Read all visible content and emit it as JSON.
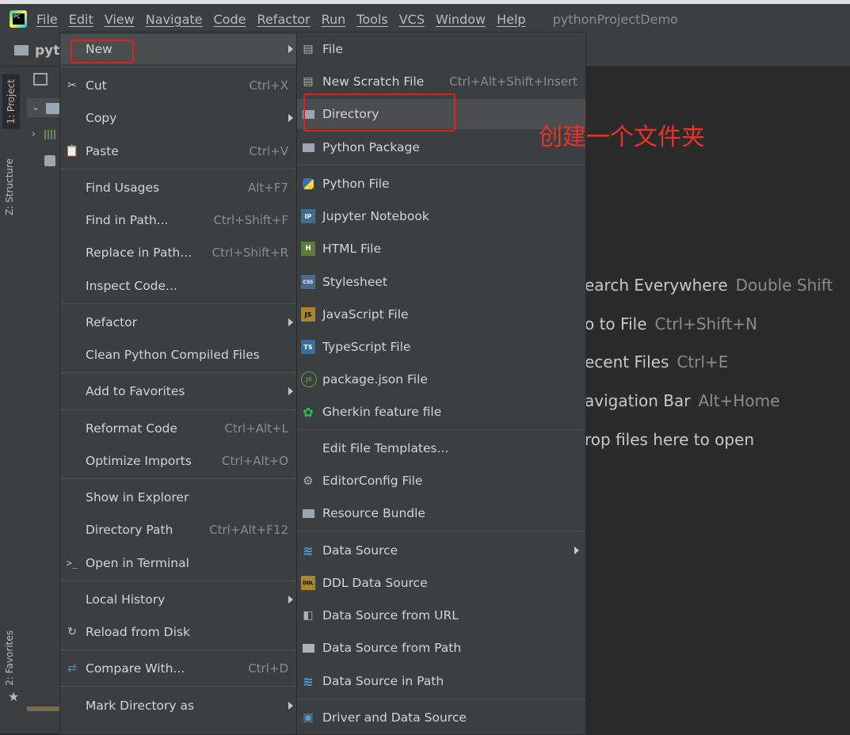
{
  "menubar": {
    "items": [
      "File",
      "Edit",
      "View",
      "Navigate",
      "Code",
      "Refactor",
      "Run",
      "Tools",
      "VCS",
      "Window",
      "Help"
    ],
    "project": "pythonProjectDemo",
    "logo": "PC"
  },
  "nav": {
    "title": "pyth"
  },
  "toolstrip": {
    "project_tab": "1: Project",
    "structure_tab": "Z: Structure",
    "favorites_tab": "2: Favorites"
  },
  "hints": [
    {
      "label": "earch Everywhere",
      "shortcut": "Double Shift"
    },
    {
      "label": "o to File",
      "shortcut": "Ctrl+Shift+N"
    },
    {
      "label": "ecent Files",
      "shortcut": "Ctrl+E"
    },
    {
      "label": "avigation Bar",
      "shortcut": "Alt+Home"
    },
    {
      "label": "rop files here to open",
      "shortcut": ""
    }
  ],
  "context_menu": {
    "new": "New",
    "cut": {
      "label": "Cut",
      "shortcut": "Ctrl+X"
    },
    "copy": "Copy",
    "paste": {
      "label": "Paste",
      "shortcut": "Ctrl+V"
    },
    "find_usages": {
      "label": "Find Usages",
      "shortcut": "Alt+F7"
    },
    "find_in_path": {
      "label": "Find in Path...",
      "shortcut": "Ctrl+Shift+F"
    },
    "replace_in_path": {
      "label": "Replace in Path...",
      "shortcut": "Ctrl+Shift+R"
    },
    "inspect_code": "Inspect Code...",
    "refactor": "Refactor",
    "clean": "Clean Python Compiled Files",
    "add_favorites": "Add to Favorites",
    "reformat": {
      "label": "Reformat Code",
      "shortcut": "Ctrl+Alt+L"
    },
    "optimize": {
      "label": "Optimize Imports",
      "shortcut": "Ctrl+Alt+O"
    },
    "show_explorer": "Show in Explorer",
    "dir_path": {
      "label": "Directory Path",
      "shortcut": "Ctrl+Alt+F12"
    },
    "terminal": "Open in Terminal",
    "local_history": "Local History",
    "reload": "Reload from Disk",
    "compare": {
      "label": "Compare With...",
      "shortcut": "Ctrl+D"
    },
    "mark_dir": "Mark Directory as"
  },
  "submenu": {
    "file": "File",
    "scratch": {
      "label": "New Scratch File",
      "shortcut": "Ctrl+Alt+Shift+Insert"
    },
    "directory": "Directory",
    "python_package": "Python Package",
    "python_file": "Python File",
    "jupyter": "Jupyter Notebook",
    "html": "HTML File",
    "stylesheet": "Stylesheet",
    "js": "JavaScript File",
    "ts": "TypeScript File",
    "package_json": "package.json File",
    "gherkin": "Gherkin feature file",
    "edit_templates": "Edit File Templates...",
    "editorconfig": "EditorConfig File",
    "resource_bundle": "Resource Bundle",
    "data_source": "Data Source",
    "ddl": "DDL Data Source",
    "ds_url": "Data Source from URL",
    "ds_path": "Data Source from Path",
    "ds_in_path": "Data Source in Path",
    "driver": "Driver and Data Source"
  },
  "icon_labels": {
    "jupyter": "IP",
    "html": "H",
    "css": "CSS",
    "js": "JS",
    "ts": "TS",
    "ddl": "DDL",
    "pkg": "JS"
  },
  "annotation": "创建一个文件夹",
  "colors": {
    "accent_red": "#e02020",
    "menu_bg": "#3c3f41",
    "selected": "#4b4d4f"
  }
}
